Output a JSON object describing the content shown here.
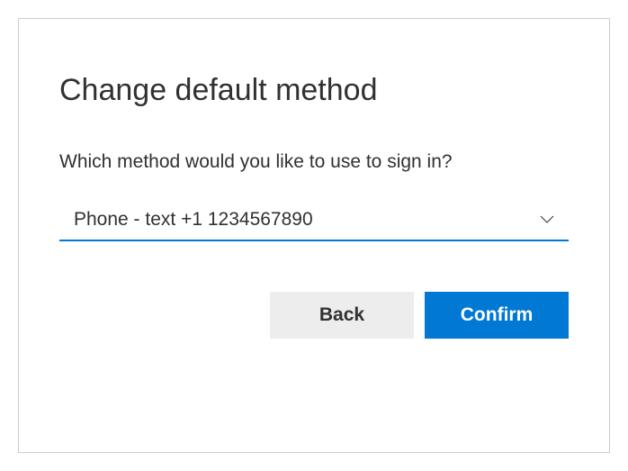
{
  "dialog": {
    "title": "Change default method",
    "prompt": "Which method would you like to use to sign in?"
  },
  "dropdown": {
    "selected": "Phone - text +1 1234567890"
  },
  "buttons": {
    "back": "Back",
    "confirm": "Confirm"
  },
  "colors": {
    "primary": "#0078d4",
    "text": "#323130",
    "secondaryButton": "#ededed"
  }
}
